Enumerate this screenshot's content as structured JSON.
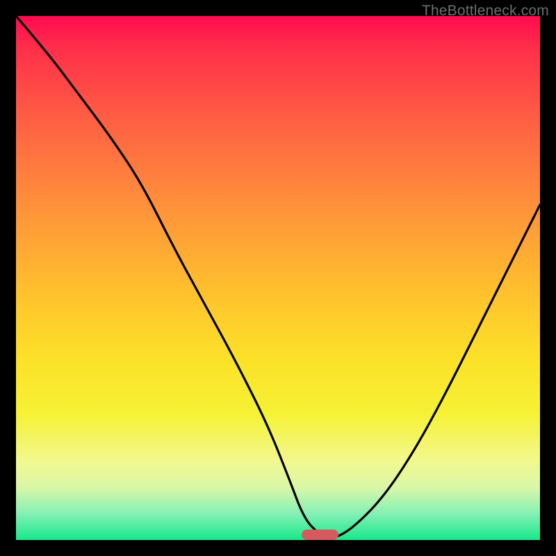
{
  "watermark": "TheBottleneck.com",
  "colors": {
    "frame": "#000000",
    "gradient_top": "#ff0a4f",
    "gradient_bottom": "#17e88b",
    "curve": "#000000",
    "marker": "#d55a5f"
  },
  "chart_data": {
    "type": "line",
    "title": "",
    "xlabel": "",
    "ylabel": "",
    "xlim": [
      0,
      100
    ],
    "ylim": [
      0,
      100
    ],
    "series": [
      {
        "name": "bottleneck-curve",
        "x": [
          0,
          6,
          12,
          18,
          24,
          30,
          36,
          42,
          48,
          52,
          55,
          58,
          60,
          64,
          70,
          76,
          82,
          88,
          94,
          100
        ],
        "values": [
          100,
          93,
          85,
          77,
          68,
          56,
          45,
          34,
          22,
          12,
          4,
          1,
          0,
          2,
          8,
          17,
          28,
          40,
          52,
          64
        ]
      }
    ],
    "marker": {
      "x_center": 58,
      "width": 7,
      "y": 0.7
    },
    "grid": false,
    "legend": false
  }
}
